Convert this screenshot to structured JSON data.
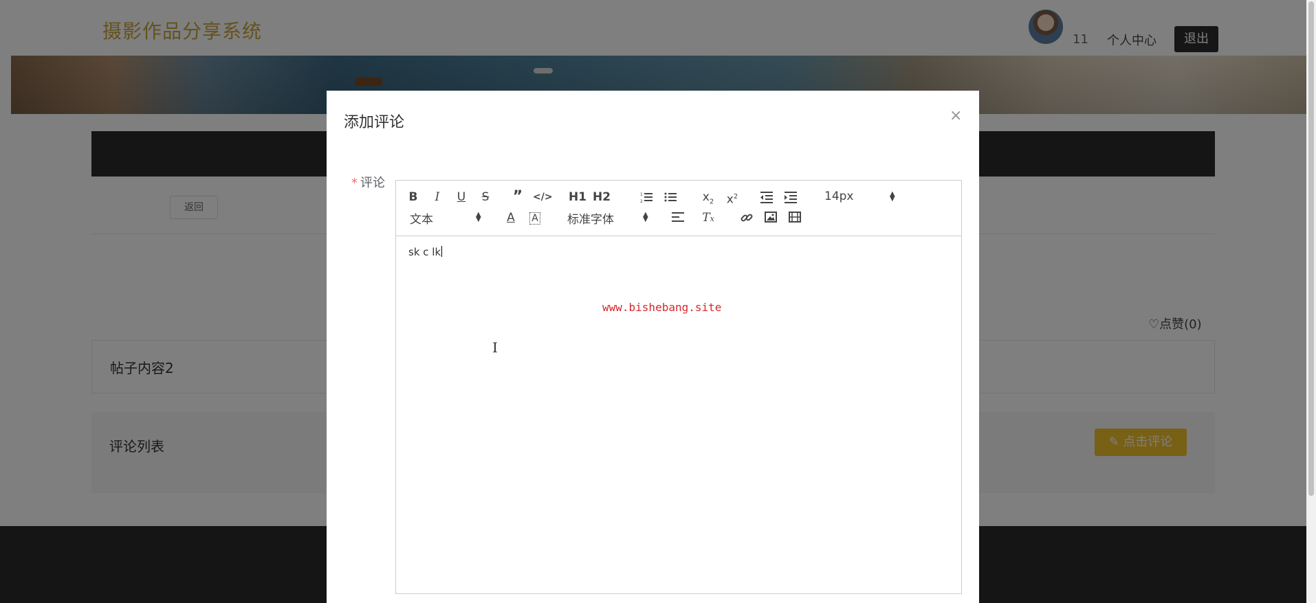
{
  "header": {
    "logo": "摄影作品分享系统",
    "username": "11",
    "user_center": "个人中心",
    "logout": "退出"
  },
  "detail": {
    "back": "返回",
    "like": "点赞(0)",
    "content": "帖子内容2",
    "comment_list_title": "评论列表",
    "comment_button": "点击评论"
  },
  "modal": {
    "title": "添加评论",
    "close": "×",
    "field_label": "评论",
    "required_mark": "*",
    "editor": {
      "toolbar": {
        "font_size": "14px",
        "heading_select": "文本",
        "font_family": "标准字体",
        "h1": "H1",
        "h2": "H2"
      },
      "content": "sk c lk",
      "watermark": "www.bishebang.site"
    }
  },
  "icons": [
    "bold-icon",
    "italic-icon",
    "underline-icon",
    "strike-icon",
    "blockquote-icon",
    "code-block-icon",
    "ordered-list-icon",
    "bullet-list-icon",
    "subscript-icon",
    "superscript-icon",
    "outdent-icon",
    "indent-icon",
    "font-color-icon",
    "background-color-icon",
    "align-icon",
    "clean-format-icon",
    "link-icon",
    "image-icon",
    "video-icon",
    "heart-icon",
    "edit-icon",
    "close-icon"
  ],
  "colors": {
    "logo": "#c9a43a",
    "accent": "#f0c02a",
    "dark": "#2a2a2a",
    "required": "#f56c6c",
    "watermark": "#d8262c"
  }
}
